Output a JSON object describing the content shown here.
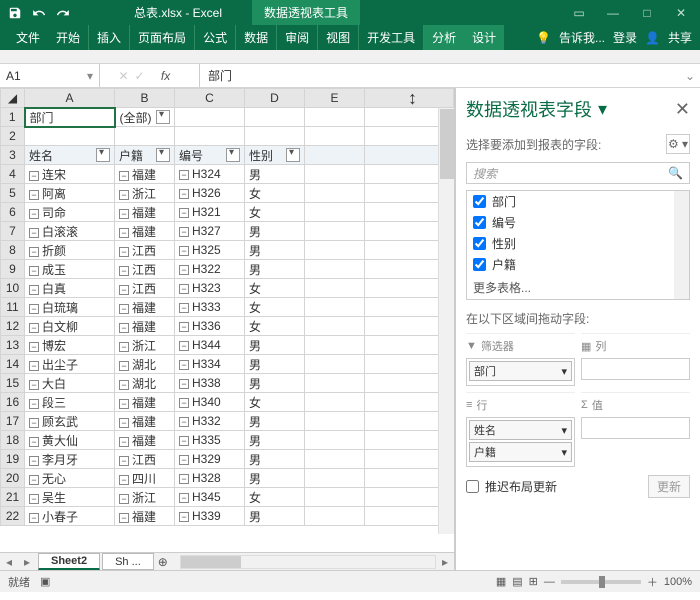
{
  "titlebar": {
    "doc_title": "总表.xlsx - Excel",
    "context_tool": "数据透视表工具"
  },
  "ribbon": {
    "tabs": [
      "文件",
      "开始",
      "插入",
      "页面布局",
      "公式",
      "数据",
      "审阅",
      "视图",
      "开发工具",
      "分析",
      "设计"
    ],
    "tell_me": "告诉我...",
    "signin": "登录",
    "share": "共享"
  },
  "namebox": {
    "ref": "A1"
  },
  "formula": {
    "fx": "fx",
    "value": "部门"
  },
  "columns": [
    "A",
    "B",
    "C",
    "D",
    "E"
  ],
  "row1": {
    "a": "部门",
    "b": "(全部)"
  },
  "row3": {
    "a": "姓名",
    "b": "户籍",
    "c": "编号",
    "d": "性别"
  },
  "rows": [
    {
      "n": 4,
      "a": "连宋",
      "b": "福建",
      "c": "H324",
      "d": "男"
    },
    {
      "n": 5,
      "a": "阿离",
      "b": "浙江",
      "c": "H326",
      "d": "女"
    },
    {
      "n": 6,
      "a": "司命",
      "b": "福建",
      "c": "H321",
      "d": "女"
    },
    {
      "n": 7,
      "a": "白滚滚",
      "b": "福建",
      "c": "H327",
      "d": "男"
    },
    {
      "n": 8,
      "a": "折颜",
      "b": "江西",
      "c": "H325",
      "d": "男"
    },
    {
      "n": 9,
      "a": "成玉",
      "b": "江西",
      "c": "H322",
      "d": "男"
    },
    {
      "n": 10,
      "a": "白真",
      "b": "江西",
      "c": "H323",
      "d": "女"
    },
    {
      "n": 11,
      "a": "白琉璃",
      "b": "福建",
      "c": "H333",
      "d": "女"
    },
    {
      "n": 12,
      "a": "白文柳",
      "b": "福建",
      "c": "H336",
      "d": "女"
    },
    {
      "n": 13,
      "a": "博宏",
      "b": "浙江",
      "c": "H344",
      "d": "男"
    },
    {
      "n": 14,
      "a": "出尘子",
      "b": "湖北",
      "c": "H334",
      "d": "男"
    },
    {
      "n": 15,
      "a": "大白",
      "b": "湖北",
      "c": "H338",
      "d": "男"
    },
    {
      "n": 16,
      "a": "段三",
      "b": "福建",
      "c": "H340",
      "d": "女"
    },
    {
      "n": 17,
      "a": "顾玄武",
      "b": "福建",
      "c": "H332",
      "d": "男"
    },
    {
      "n": 18,
      "a": "黄大仙",
      "b": "福建",
      "c": "H335",
      "d": "男"
    },
    {
      "n": 19,
      "a": "李月牙",
      "b": "江西",
      "c": "H329",
      "d": "男"
    },
    {
      "n": 20,
      "a": "无心",
      "b": "四川",
      "c": "H328",
      "d": "男"
    },
    {
      "n": 21,
      "a": "吴生",
      "b": "浙江",
      "c": "H345",
      "d": "女"
    },
    {
      "n": 22,
      "a": "小春子",
      "b": "福建",
      "c": "H339",
      "d": "男"
    }
  ],
  "sheets": {
    "active": "Sheet2",
    "other": "Sh ..."
  },
  "pane": {
    "title": "数据透视表字段",
    "subtitle": "选择要添加到报表的字段:",
    "search_placeholder": "搜索",
    "fields": [
      {
        "label": "部门",
        "checked": true
      },
      {
        "label": "编号",
        "checked": true
      },
      {
        "label": "性别",
        "checked": true
      },
      {
        "label": "户籍",
        "checked": true
      }
    ],
    "more_tables": "更多表格...",
    "drag_label": "在以下区域间拖动字段:",
    "areas": {
      "filters_label": "筛选器",
      "filters_chip": "部门",
      "columns_label": "列",
      "rows_label": "行",
      "rows_chip1": "姓名",
      "rows_chip2": "户籍",
      "values_label": "值"
    },
    "defer": "推迟布局更新",
    "update": "更新"
  },
  "status": {
    "ready": "就绪",
    "zoom": "100%"
  }
}
